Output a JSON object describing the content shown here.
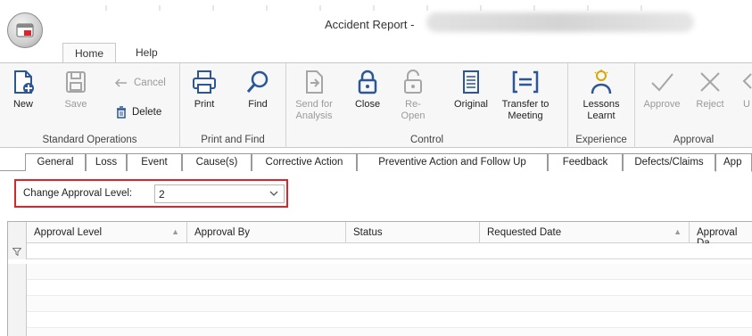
{
  "window": {
    "title": "Accident Report -"
  },
  "ribbon_tabs": [
    {
      "label": "Home",
      "active": true
    },
    {
      "label": "Help",
      "active": false
    }
  ],
  "groups": {
    "standard_operations": {
      "label": "Standard Operations",
      "new": "New",
      "save": "Save",
      "cancel": "Cancel",
      "delete": "Delete"
    },
    "print_find": {
      "label": "Print and Find",
      "print": "Print",
      "find": "Find"
    },
    "control": {
      "label": "Control",
      "send_line1": "Send for",
      "send_line2": "Analysis",
      "close": "Close",
      "reopen": "Re-Open",
      "original": "Original",
      "transfer_line1": "Transfer to",
      "transfer_line2": "Meeting"
    },
    "experience": {
      "label": "Experience",
      "lessons_line1": "Lessons",
      "lessons_line2": "Learnt"
    },
    "approval": {
      "label": "Approval",
      "approve": "Approve",
      "reject": "Reject",
      "more": "U"
    }
  },
  "form_tabs": [
    "General",
    "Loss",
    "Event",
    "Cause(s)",
    "Corrective Action",
    "Preventive Action and Follow Up",
    "Feedback",
    "Defects/Claims",
    "App"
  ],
  "approval_level": {
    "label": "Change Approval Level:",
    "value": "2"
  },
  "grid": {
    "columns": [
      "Approval Level",
      "Approval By",
      "Status",
      "Requested Date",
      "Approval Da"
    ],
    "rows": []
  },
  "colors": {
    "highlight_border": "#e0222a",
    "accent_icon": "#2b5797",
    "disabled_text": "#9a9a9a"
  }
}
